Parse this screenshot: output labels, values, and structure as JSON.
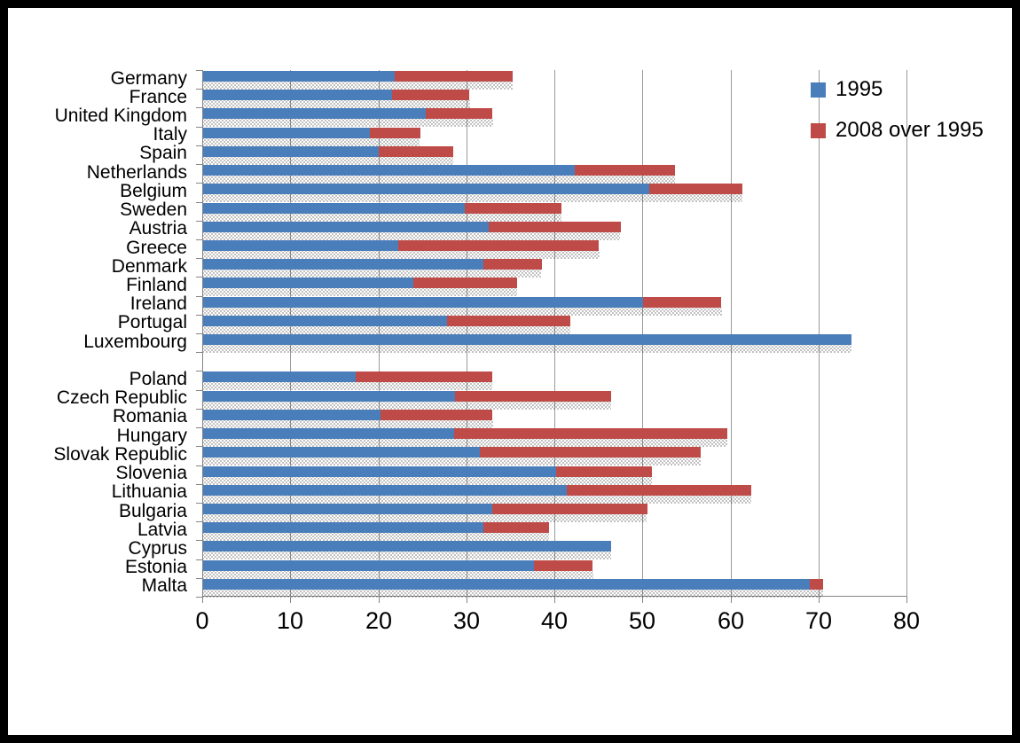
{
  "chart_data": {
    "type": "bar",
    "orientation": "horizontal",
    "stacked": true,
    "title": "",
    "xlabel": "",
    "ylabel": "",
    "xlim": [
      0,
      80
    ],
    "xticks": [
      0,
      10,
      20,
      30,
      40,
      50,
      60,
      70,
      80
    ],
    "grid": true,
    "legend_position": "top-right",
    "colors": {
      "series_1995": "#4a7ebb",
      "series_2008_over_1995": "#be4b48",
      "gridline": "#9a9a9a",
      "axis": "#868686",
      "background": "#ffffff",
      "border": "#000000"
    },
    "categories": [
      "Germany",
      "France",
      "United Kingdom",
      "Italy",
      "Spain",
      "Netherlands",
      "Belgium",
      "Sweden",
      "Austria",
      "Greece",
      "Denmark",
      "Finland",
      "Ireland",
      "Portugal",
      "Luxembourg",
      "",
      "Poland",
      "Czech Republic",
      "Romania",
      "Hungary",
      "Slovak Republic",
      "Slovenia",
      "Lithuania",
      "Bulgaria",
      "Latvia",
      "Cyprus",
      "Estonia",
      "Malta"
    ],
    "series": [
      {
        "name": "1995",
        "color": "#4a7ebb",
        "values": [
          21.8,
          21.5,
          25.3,
          18.9,
          19.9,
          42.2,
          50.7,
          29.7,
          32.4,
          22.2,
          31.8,
          23.9,
          50.0,
          27.7,
          73.7,
          null,
          17.3,
          28.6,
          20.2,
          28.5,
          31.4,
          40.1,
          41.3,
          32.8,
          31.8,
          46.3,
          37.6,
          68.9
        ]
      },
      {
        "name": "2008 over 1995",
        "color": "#be4b48",
        "values": [
          13.4,
          8.8,
          7.6,
          5.7,
          8.5,
          11.4,
          10.6,
          11.0,
          15.0,
          22.8,
          6.6,
          11.8,
          8.9,
          14.0,
          0.0,
          null,
          15.5,
          17.7,
          12.7,
          31.0,
          25.1,
          10.9,
          21.0,
          17.6,
          7.5,
          0.0,
          6.7,
          1.5
        ]
      }
    ],
    "totals": [
      35.2,
      30.3,
      32.9,
      24.6,
      28.4,
      53.6,
      61.3,
      40.7,
      47.4,
      45.0,
      38.4,
      35.7,
      58.9,
      41.7,
      73.7,
      null,
      32.8,
      46.3,
      32.9,
      59.5,
      56.5,
      51.0,
      62.3,
      50.4,
      39.3,
      46.3,
      44.3,
      70.4
    ]
  },
  "legend": {
    "items": [
      {
        "label": "1995",
        "color": "#4a7ebb"
      },
      {
        "label": "2008 over 1995",
        "color": "#be4b48"
      }
    ]
  },
  "axis": {
    "x_tick_labels": [
      "0",
      "10",
      "20",
      "30",
      "40",
      "50",
      "60",
      "70",
      "80"
    ]
  }
}
